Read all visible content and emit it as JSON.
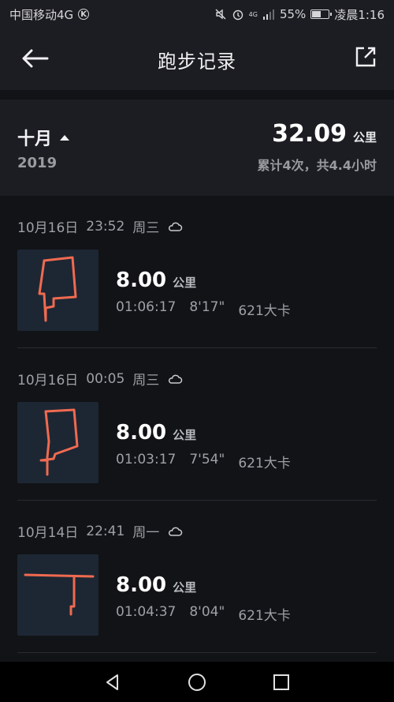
{
  "status": {
    "carrier": "中国移动4G",
    "k_badge": "K",
    "signal_label": "4G",
    "battery_percent": "55%",
    "battery_level": 0.55,
    "time": "凌晨1:16"
  },
  "header": {
    "title": "跑步记录"
  },
  "summary": {
    "month": "十月",
    "year": "2019",
    "total_distance": "32.09",
    "unit": "公里",
    "detail": "累计4次，共4.4小时"
  },
  "runs": [
    {
      "date": "10月16日",
      "time": "23:52",
      "weekday": "周三",
      "distance": "8.00",
      "unit": "公里",
      "duration": "01:06:17",
      "pace": "8'17\"",
      "calories": "621大卡"
    },
    {
      "date": "10月16日",
      "time": "00:05",
      "weekday": "周三",
      "distance": "8.00",
      "unit": "公里",
      "duration": "01:03:17",
      "pace": "7'54\"",
      "calories": "621大卡"
    },
    {
      "date": "10月14日",
      "time": "22:41",
      "weekday": "周一",
      "distance": "8.00",
      "unit": "公里",
      "duration": "01:04:37",
      "pace": "8'04\"",
      "calories": "621大卡"
    }
  ],
  "colors": {
    "route": "#f06a50",
    "background": "#121317",
    "card": "#1c1d22"
  }
}
